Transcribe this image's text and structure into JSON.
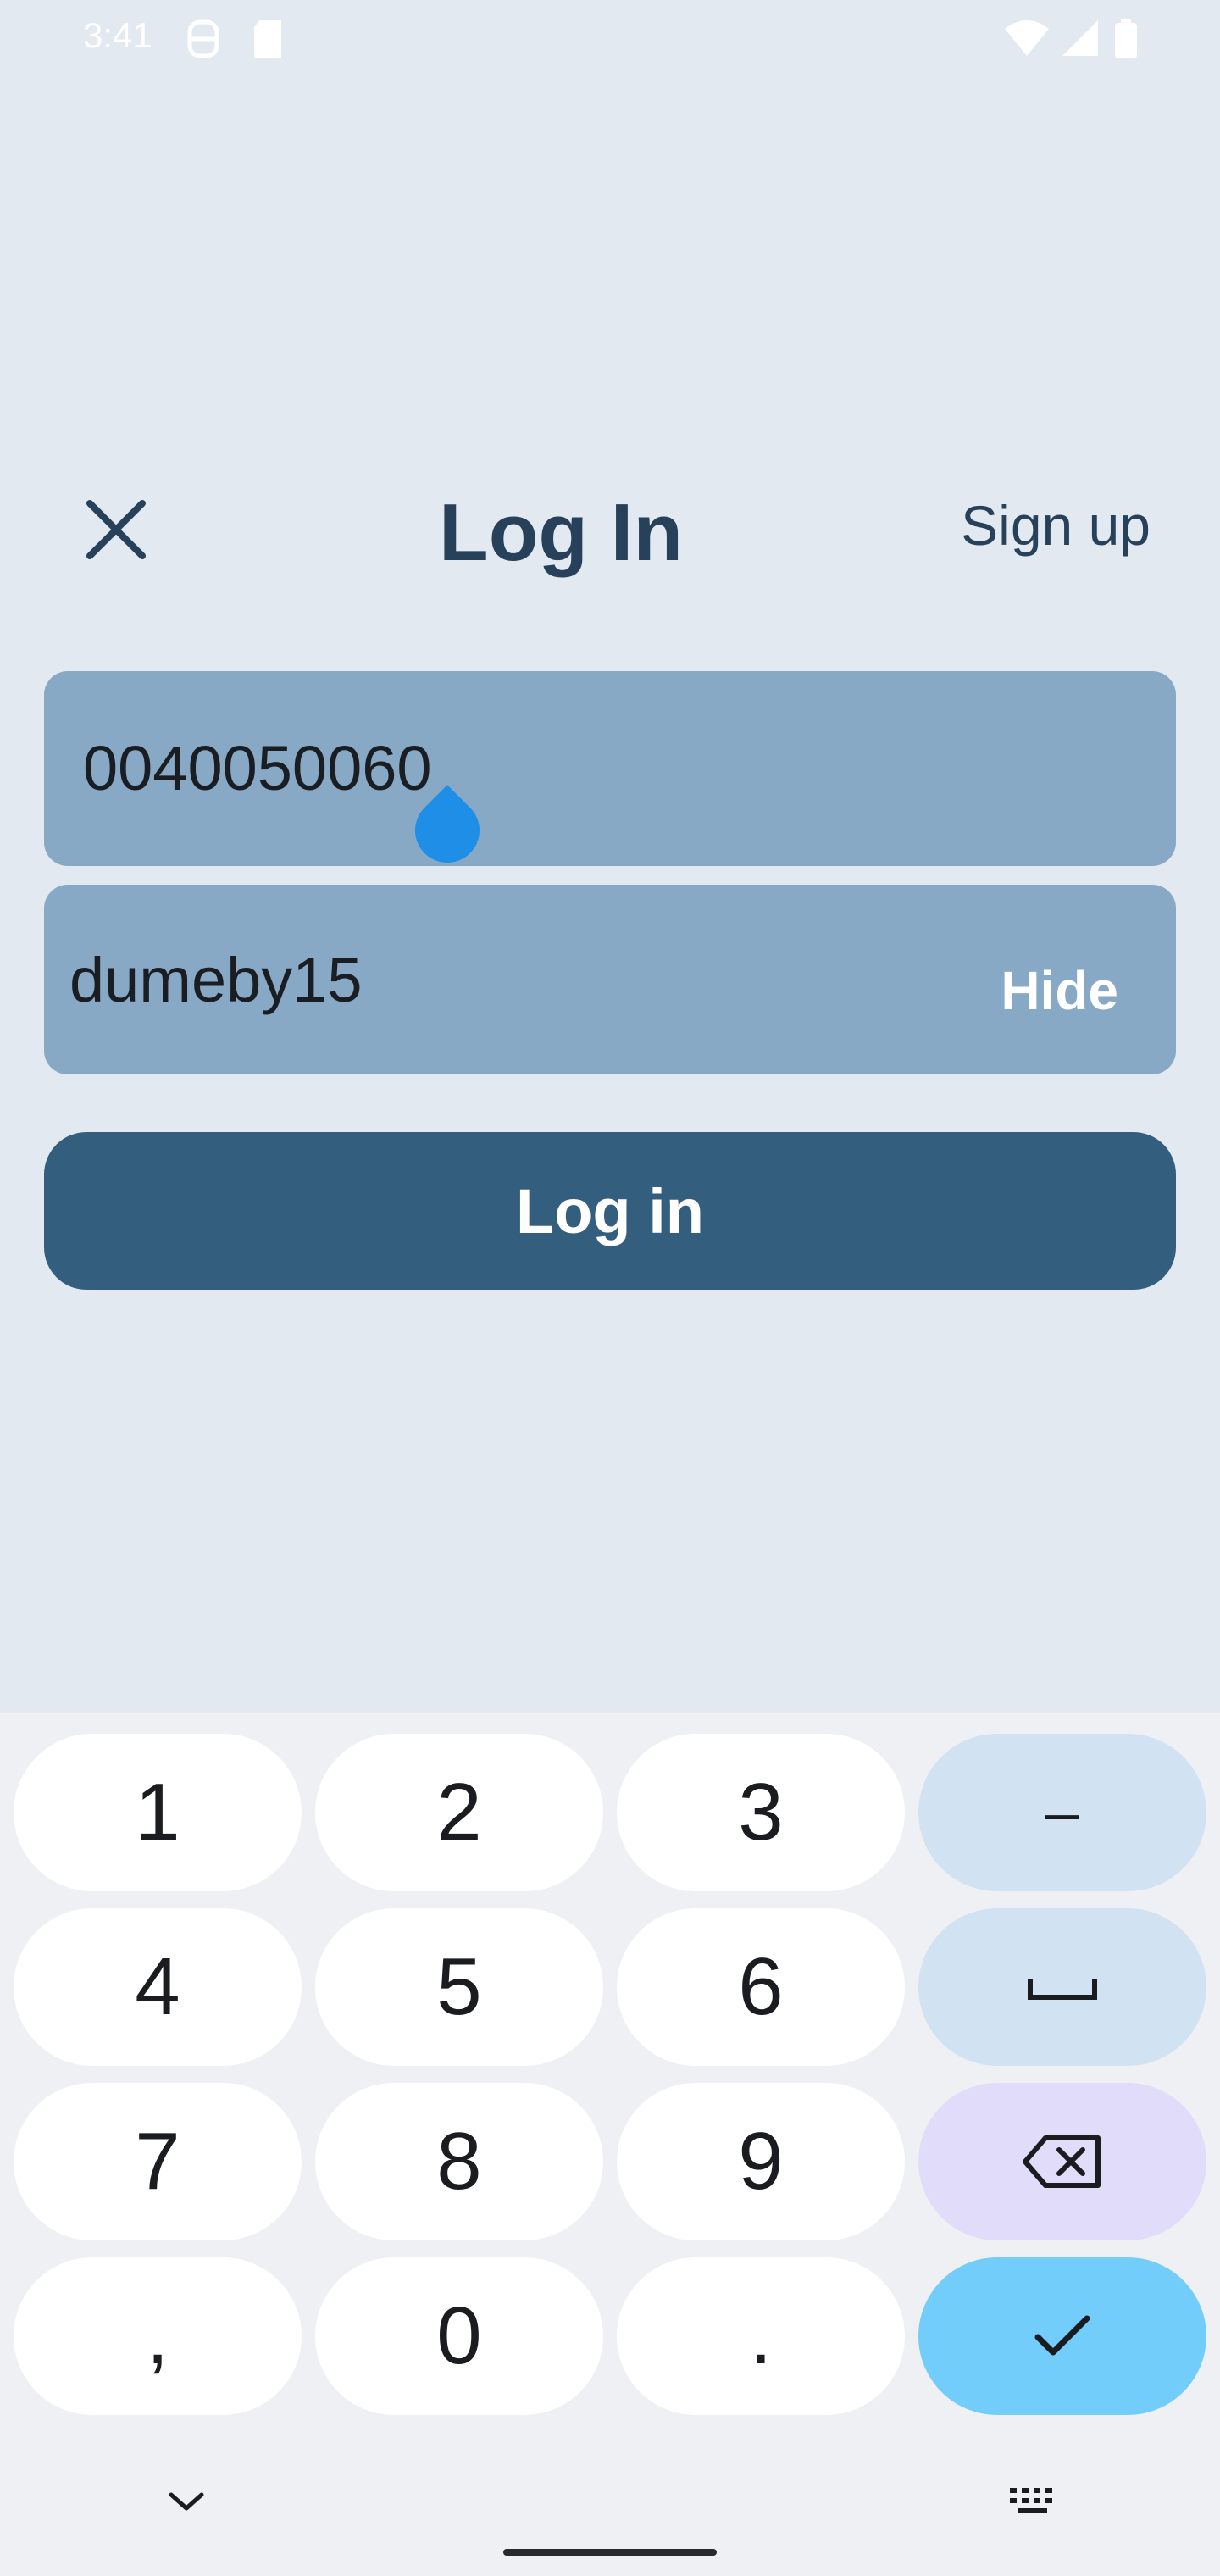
{
  "status_bar": {
    "time": "3:41",
    "icons": [
      "face-id-icon",
      "sd-card-icon",
      "wifi-icon",
      "signal-icon",
      "battery-icon"
    ]
  },
  "header": {
    "title": "Log In",
    "signup_label": "Sign up",
    "close_icon": "close-icon"
  },
  "form": {
    "phone_value": "0040050060",
    "password_value": "dumeby15",
    "hide_label": "Hide",
    "login_label": "Log in"
  },
  "keyboard": {
    "keys": [
      {
        "label": "1",
        "kind": "digit"
      },
      {
        "label": "2",
        "kind": "digit"
      },
      {
        "label": "3",
        "kind": "digit"
      },
      {
        "label": "–",
        "kind": "fn"
      },
      {
        "label": "4",
        "kind": "digit"
      },
      {
        "label": "5",
        "kind": "digit"
      },
      {
        "label": "6",
        "kind": "digit"
      },
      {
        "label": "space-icon",
        "kind": "fn"
      },
      {
        "label": "7",
        "kind": "digit"
      },
      {
        "label": "8",
        "kind": "digit"
      },
      {
        "label": "9",
        "kind": "digit"
      },
      {
        "label": "backspace-icon",
        "kind": "backspace"
      },
      {
        "label": ",",
        "kind": "digit"
      },
      {
        "label": "0",
        "kind": "digit"
      },
      {
        "label": ".",
        "kind": "digit"
      },
      {
        "label": "check-icon",
        "kind": "enter"
      }
    ],
    "bottom_icons": [
      "chevron-down-icon",
      "keyboard-icon"
    ]
  },
  "colors": {
    "background": "#e2e9f1",
    "title": "#27415a",
    "field": "#87a9c5",
    "button": "#335e7e",
    "cursor": "#1e8ee6",
    "enter_key": "#73cdfa"
  }
}
